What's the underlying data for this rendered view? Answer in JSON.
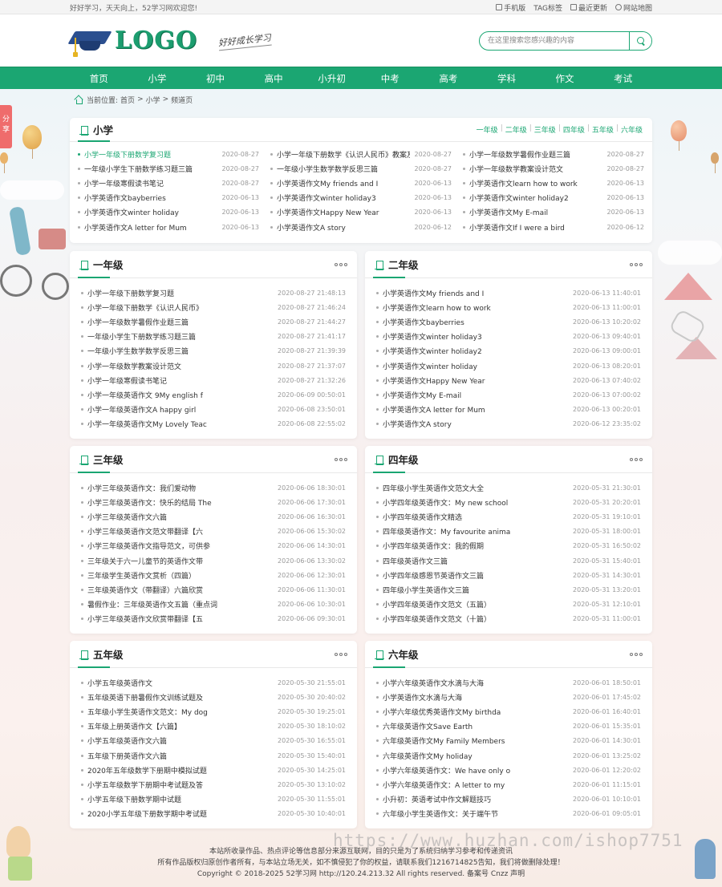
{
  "topbar": {
    "welcome": "好好学习，天天向上，52学习网欢迎您!",
    "links": [
      "手机版",
      "TAG标签",
      "最近更新",
      "网站地图"
    ]
  },
  "header": {
    "logo_text": "LOGO",
    "slogan": "好好成长学习",
    "search_placeholder": "在这里搜索您感兴趣的内容"
  },
  "nav": [
    "首页",
    "小学",
    "初中",
    "高中",
    "小升初",
    "中考",
    "高考",
    "学科",
    "作文",
    "考试"
  ],
  "share_label": "分享",
  "breadcrumb": {
    "prefix": "当前位置:",
    "items": [
      "首页",
      "小学",
      "频道页"
    ],
    "sep": ">"
  },
  "featured": {
    "title": "小学",
    "grade_links": [
      "一年级",
      "二年级",
      "三年级",
      "四年级",
      "五年级",
      "六年级"
    ],
    "columns": [
      [
        {
          "t": "小学一年级下册数学复习题",
          "d": "2020-08-27"
        },
        {
          "t": "一年级小学生下册数学练习题三篇",
          "d": "2020-08-27"
        },
        {
          "t": "小学一年级寒假读书笔记",
          "d": "2020-08-27"
        },
        {
          "t": "小学英语作文bayberries",
          "d": "2020-06-13"
        },
        {
          "t": "小学英语作文winter holiday",
          "d": "2020-06-13"
        },
        {
          "t": "小学英语作文A letter for Mum",
          "d": "2020-06-13"
        }
      ],
      [
        {
          "t": "小学一年级下册数学《认识人民币》教案及教",
          "d": "2020-08-27"
        },
        {
          "t": "一年级小学生数学数学反思三篇",
          "d": "2020-08-27"
        },
        {
          "t": "小学英语作文My friends and I",
          "d": "2020-06-13"
        },
        {
          "t": "小学英语作文winter holiday3",
          "d": "2020-06-13"
        },
        {
          "t": "小学英语作文Happy New Year",
          "d": "2020-06-13"
        },
        {
          "t": "小学英语作文A story",
          "d": "2020-06-12"
        }
      ],
      [
        {
          "t": "小学一年级数学暑假作业题三篇",
          "d": "2020-08-27"
        },
        {
          "t": "小学一年级数学教案设计范文",
          "d": "2020-08-27"
        },
        {
          "t": "小学英语作文learn how to work",
          "d": "2020-06-13"
        },
        {
          "t": "小学英语作文winter holiday2",
          "d": "2020-06-13"
        },
        {
          "t": "小学英语作文My E-mail",
          "d": "2020-06-13"
        },
        {
          "t": "小学英语作文If I were a bird",
          "d": "2020-06-12"
        }
      ]
    ]
  },
  "grades": [
    {
      "title": "一年级",
      "items": [
        {
          "t": "小学一年级下册数学复习题",
          "d": "2020-08-27 21:48:13"
        },
        {
          "t": "小学一年级下册数学《认识人民币》",
          "d": "2020-08-27 21:46:24"
        },
        {
          "t": "小学一年级数学暑假作业题三篇",
          "d": "2020-08-27 21:44:27"
        },
        {
          "t": "一年级小学生下册数学练习题三篇",
          "d": "2020-08-27 21:41:17"
        },
        {
          "t": "一年级小学生数学数学反思三篇",
          "d": "2020-08-27 21:39:39"
        },
        {
          "t": "小学一年级数学教案设计范文",
          "d": "2020-08-27 21:37:07"
        },
        {
          "t": "小学一年级寒假读书笔记",
          "d": "2020-08-27 21:32:26"
        },
        {
          "t": "小学一年级英语作文 9My english f",
          "d": "2020-06-09 00:50:01"
        },
        {
          "t": "小学一年级英语作文A happy girl",
          "d": "2020-06-08 23:50:01"
        },
        {
          "t": "小学一年级英语作文My Lovely Teac",
          "d": "2020-06-08 22:55:02"
        }
      ]
    },
    {
      "title": "二年级",
      "items": [
        {
          "t": "小学英语作文My friends and I",
          "d": "2020-06-13 11:40:01"
        },
        {
          "t": "小学英语作文learn how to work",
          "d": "2020-06-13 11:00:01"
        },
        {
          "t": "小学英语作文bayberries",
          "d": "2020-06-13 10:20:02"
        },
        {
          "t": "小学英语作文winter holiday3",
          "d": "2020-06-13 09:40:01"
        },
        {
          "t": "小学英语作文winter holiday2",
          "d": "2020-06-13 09:00:01"
        },
        {
          "t": "小学英语作文winter holiday",
          "d": "2020-06-13 08:20:01"
        },
        {
          "t": "小学英语作文Happy New Year",
          "d": "2020-06-13 07:40:02"
        },
        {
          "t": "小学英语作文My E-mail",
          "d": "2020-06-13 07:00:02"
        },
        {
          "t": "小学英语作文A letter for Mum",
          "d": "2020-06-13 00:20:01"
        },
        {
          "t": "小学英语作文A story",
          "d": "2020-06-12 23:35:02"
        }
      ]
    },
    {
      "title": "三年级",
      "items": [
        {
          "t": "小学三年级英语作文：我们爱动物",
          "d": "2020-06-06 18:30:01"
        },
        {
          "t": "小学三年级英语作文：快乐的结局 The",
          "d": "2020-06-06 17:30:01"
        },
        {
          "t": "小学三年级英语作文六篇",
          "d": "2020-06-06 16:30:01"
        },
        {
          "t": "小学三年级英语作文范文带翻译【六",
          "d": "2020-06-06 15:30:02"
        },
        {
          "t": "小学三年级英语作文指导范文，可供参",
          "d": "2020-06-06 14:30:01"
        },
        {
          "t": "三年级关于六一儿童节的英语作文带",
          "d": "2020-06-06 13:30:02"
        },
        {
          "t": "三年级学生英语作文赏析（四篇）",
          "d": "2020-06-06 12:30:01"
        },
        {
          "t": "三年级英语作文（带翻译）六篇欣赏",
          "d": "2020-06-06 11:30:01"
        },
        {
          "t": "暑假作业：三年级英语作文五篇（重点词",
          "d": "2020-06-06 10:30:01"
        },
        {
          "t": "小学三年级英语作文欣赏带翻译【五",
          "d": "2020-06-06 09:30:01"
        }
      ]
    },
    {
      "title": "四年级",
      "items": [
        {
          "t": "四年级小学生英语作文范文大全",
          "d": "2020-05-31 21:30:01"
        },
        {
          "t": "小学四年级英语作文：My new school",
          "d": "2020-05-31 20:20:01"
        },
        {
          "t": "小学四年级英语作文精选",
          "d": "2020-05-31 19:10:01"
        },
        {
          "t": "四年级英语作文：My favourite anima",
          "d": "2020-05-31 18:00:01"
        },
        {
          "t": "小学四年级英语作文：我的假期",
          "d": "2020-05-31 16:50:02"
        },
        {
          "t": "四年级英语作文三篇",
          "d": "2020-05-31 15:40:01"
        },
        {
          "t": "小学四年级感恩节英语作文三篇",
          "d": "2020-05-31 14:30:01"
        },
        {
          "t": "四年级小学生英语作文三篇",
          "d": "2020-05-31 13:20:01"
        },
        {
          "t": "小学四年级英语作文范文（五篇）",
          "d": "2020-05-31 12:10:01"
        },
        {
          "t": "小学四年级英语作文范文（十篇）",
          "d": "2020-05-31 11:00:01"
        }
      ]
    },
    {
      "title": "五年级",
      "items": [
        {
          "t": "小学五年级英语作文",
          "d": "2020-05-30 21:55:01"
        },
        {
          "t": "五年级英语下册暑假作文训练试题及",
          "d": "2020-05-30 20:40:02"
        },
        {
          "t": "五年级小学生英语作文范文：My dog",
          "d": "2020-05-30 19:25:01"
        },
        {
          "t": "五年级上册英语作文【六篇】",
          "d": "2020-05-30 18:10:02"
        },
        {
          "t": "小学五年级英语作文六篇",
          "d": "2020-05-30 16:55:01"
        },
        {
          "t": "五年级下册英语作文六篇",
          "d": "2020-05-30 15:40:01"
        },
        {
          "t": "2020年五年级数学下册期中模拟试题",
          "d": "2020-05-30 14:25:01"
        },
        {
          "t": "小学五年级数学下册期中考试题及答",
          "d": "2020-05-30 13:10:02"
        },
        {
          "t": "小学五年级下册数学期中试题",
          "d": "2020-05-30 11:55:01"
        },
        {
          "t": "2020小学五年级下册数学期中考试题",
          "d": "2020-05-30 10:40:01"
        }
      ]
    },
    {
      "title": "六年级",
      "items": [
        {
          "t": "小学六年级英语作文水滴与大海",
          "d": "2020-06-01 18:50:01"
        },
        {
          "t": "小学英语作文水滴与大海",
          "d": "2020-06-01 17:45:02"
        },
        {
          "t": "小学六年级优秀英语作文My birthda",
          "d": "2020-06-01 16:40:01"
        },
        {
          "t": "六年级英语作文Save Earth",
          "d": "2020-06-01 15:35:01"
        },
        {
          "t": "六年级英语作文My Family Members",
          "d": "2020-06-01 14:30:01"
        },
        {
          "t": "六年级英语作文My holiday",
          "d": "2020-06-01 13:25:02"
        },
        {
          "t": "小学六年级英语作文：We have only o",
          "d": "2020-06-01 12:20:02"
        },
        {
          "t": "小学六年级英语作文：A letter to my",
          "d": "2020-06-01 11:15:01"
        },
        {
          "t": "小升初：英语考试中作文解题技巧",
          "d": "2020-06-01 10:10:01"
        },
        {
          "t": "六年级小学生英语作文：关于端午节",
          "d": "2020-06-01 09:05:01"
        }
      ]
    }
  ],
  "footer": {
    "line1": "本站所收录作品、热点评论等信息部分来源互联网，目的只是为了系统归纳学习参考和传递资讯",
    "line2": "所有作品版权归原创作者所有，与本站立场无关，如不慎侵犯了你的权益，请联系我们1216714825告知，我们将做删除处理！",
    "line3": "Copyright © 2018-2025 52学习网 http://120.24.213.32 All rights reserved. 备案号 Cnzz 声明"
  },
  "watermark": "https://www.huzhan.com/ishop7751",
  "colors": {
    "accent": "#1ba672",
    "share_tab": "#ef6c6c"
  }
}
